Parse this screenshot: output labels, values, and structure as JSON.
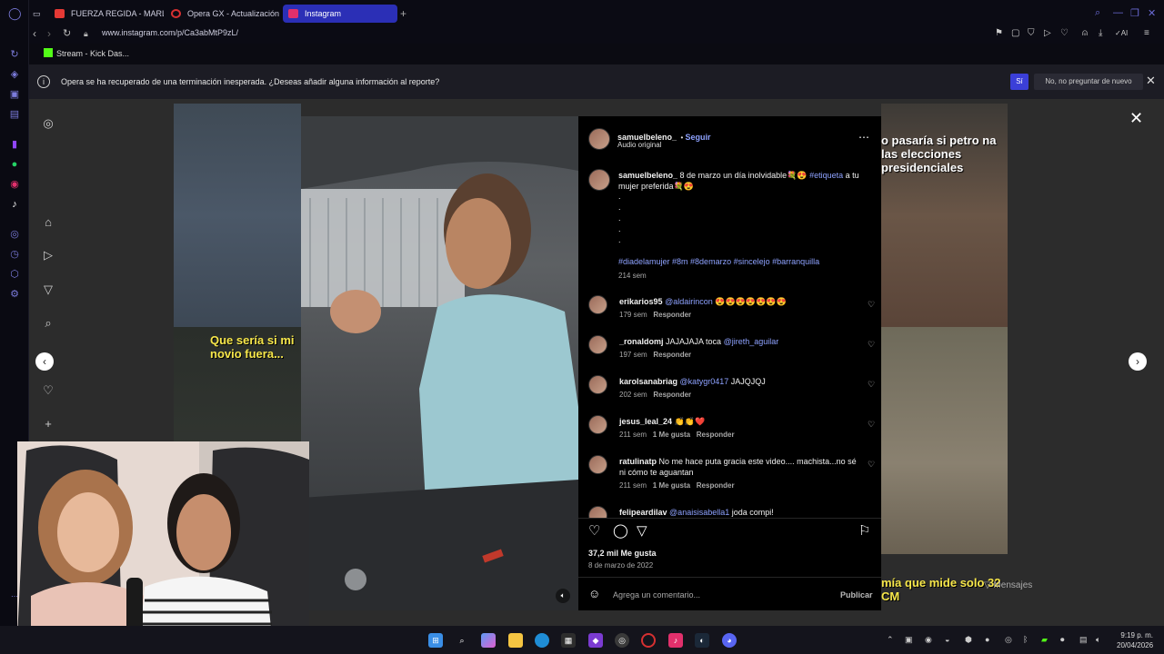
{
  "tabs": [
    {
      "label": "FUERZA REGIDA - MARLB",
      "fav_color": "#e53935",
      "active": false
    },
    {
      "label": "Opera GX - Actualización",
      "fav_color": "#d63031",
      "active": false
    },
    {
      "label": "Instagram",
      "fav_color": "#e1306c",
      "active": true
    }
  ],
  "address": {
    "url": "www.instagram.com/p/Ca3abMtP9zL/"
  },
  "bookmarks": [
    {
      "label": "Stream - Kick Das..."
    }
  ],
  "notification": {
    "message": "Opera se ha recuperado de una terminación inesperada. ¿Deseas añadir alguna información al reporte?",
    "yes_label": "Sí",
    "never_label": "No, no preguntar de nuevo"
  },
  "background_captions": {
    "left": "Que sería si mi novio fuera...",
    "right_top": "o pasaría si petro na las elecciones presidenciales",
    "right_bottom": "mía que mide solo 32 CM"
  },
  "post": {
    "username": "samuelbeleno_",
    "follow_label": "Seguir",
    "audio": "Audio original",
    "caption_user": "samuelbeleno_",
    "caption_text": "8 de marzo un día inolvidable💐😍",
    "caption_tag": "#etiqueta",
    "caption_text2": "a tu mujer preferida💐😍",
    "dots": ".",
    "hashtags": "#diadelamujer #8m #8demarzo #sincelejo #barranquilla",
    "caption_time": "214 sem",
    "likes": "37,2 mil Me gusta",
    "date": "8 de marzo de 2022",
    "comment_placeholder": "Agrega un comentario...",
    "publish_label": "Publicar"
  },
  "comments": [
    {
      "user": "erikarios95",
      "mention": "@aldairincon",
      "text": "😍😍😍😍😍😍😍",
      "time": "179 sem",
      "likes": "",
      "reply": "Responder"
    },
    {
      "user": "_ronaldomj",
      "mention": "",
      "text": "JAJAJAJA toca",
      "mention2": "@jireth_aguilar",
      "time": "197 sem",
      "likes": "",
      "reply": "Responder"
    },
    {
      "user": "karolsanabriag",
      "mention": "@katygr0417",
      "text": "JAJQJQJ",
      "time": "202 sem",
      "likes": "",
      "reply": "Responder"
    },
    {
      "user": "jesus_leal_24",
      "mention": "",
      "text": "👏👏❤️",
      "time": "211 sem",
      "likes": "1 Me gusta",
      "reply": "Responder"
    },
    {
      "user": "ratulinatp",
      "mention": "",
      "text": "No me hace puta gracia este video.... machista...no sé ni cómo te aguantan",
      "time": "211 sem",
      "likes": "1 Me gusta",
      "reply": "Responder"
    },
    {
      "user": "felipeardilav",
      "mention": "@anaisisabella1",
      "text": "joda compi!",
      "time": "",
      "likes": "",
      "reply": ""
    }
  ],
  "messages_label": "Mensajes",
  "clock": {
    "time": "9:19 p. m.",
    "date": "20/04/2026"
  }
}
